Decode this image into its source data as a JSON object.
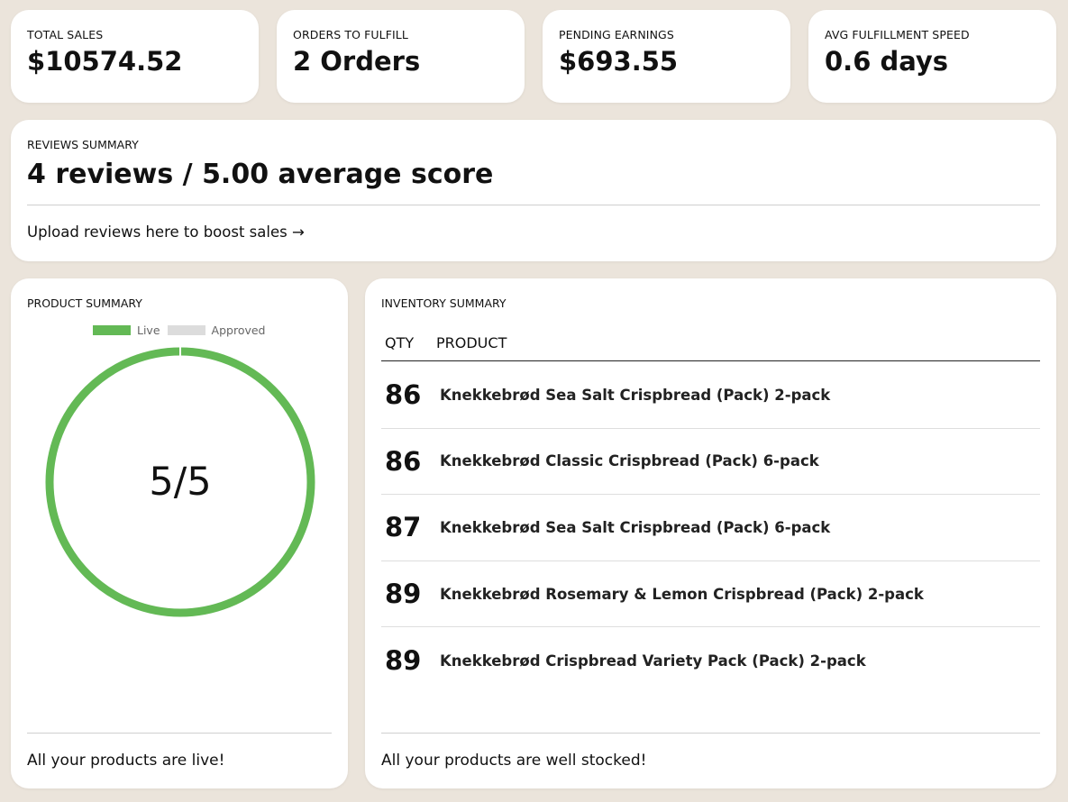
{
  "stats": [
    {
      "label": "TOTAL SALES",
      "value": "$10574.52"
    },
    {
      "label": "ORDERS TO FULFILL",
      "value": "2 Orders"
    },
    {
      "label": "PENDING EARNINGS",
      "value": "$693.55"
    },
    {
      "label": "AVG FULFILLMENT SPEED",
      "value": "0.6 days"
    }
  ],
  "reviews": {
    "label": "REVIEWS SUMMARY",
    "value": "4 reviews / 5.00 average score",
    "link": "Upload reviews here to boost sales →"
  },
  "product_summary": {
    "label": "PRODUCT SUMMARY",
    "legend": [
      {
        "label": "Live",
        "color": "#63b955"
      },
      {
        "label": "Approved",
        "color": "#dcdcdc"
      }
    ],
    "center_text": "5/5",
    "live": 5,
    "approved": 0,
    "footer": "All your products are live!"
  },
  "inventory_summary": {
    "label": "INVENTORY SUMMARY",
    "columns": {
      "qty": "QTY",
      "product": "PRODUCT"
    },
    "rows": [
      {
        "qty": "86",
        "product": "Knekkebrød Sea Salt Crispbread (Pack) 2-pack"
      },
      {
        "qty": "86",
        "product": "Knekkebrød Classic Crispbread (Pack) 6-pack"
      },
      {
        "qty": "87",
        "product": "Knekkebrød Sea Salt Crispbread (Pack) 6-pack"
      },
      {
        "qty": "89",
        "product": "Knekkebrød Rosemary & Lemon Crispbread (Pack) 2-pack"
      },
      {
        "qty": "89",
        "product": "Knekkebrød Crispbread Variety Pack (Pack) 2-pack"
      }
    ],
    "footer": "All your products are well stocked!"
  },
  "colors": {
    "background": "#ebe4db",
    "live": "#63b955",
    "approved": "#dcdcdc"
  }
}
